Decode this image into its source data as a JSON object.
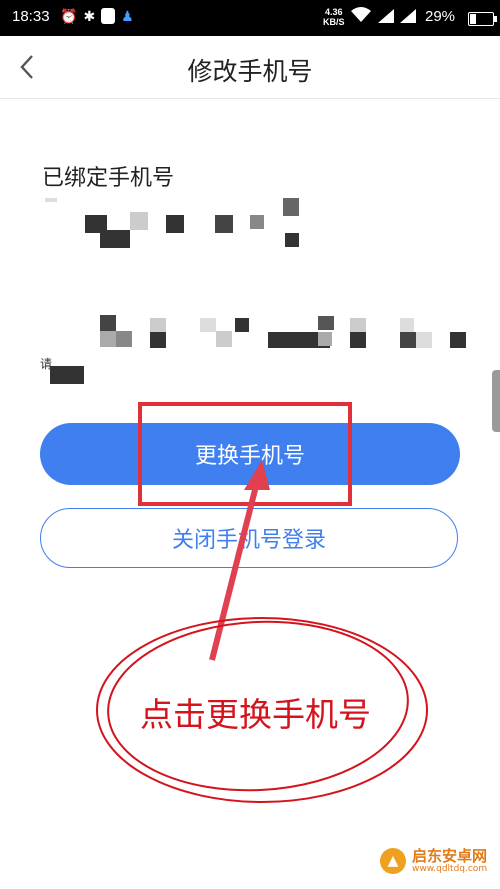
{
  "statusbar": {
    "time": "18:33",
    "speed_value": "4.36",
    "speed_unit": "KB/S",
    "battery": "29%",
    "battery_level": 0.29,
    "icons": [
      "alarm-icon",
      "bluetooth-icon",
      "shield-icon",
      "qq-icon",
      "wifi-icon",
      "signal-icon"
    ]
  },
  "header": {
    "title": "修改手机号",
    "back_icon": "chevron-left-icon"
  },
  "main": {
    "bound_label": "已绑定手机号",
    "hint_prefix": "请",
    "primary_button": "更换手机号",
    "secondary_button": "关闭手机号登录"
  },
  "annotation": {
    "text": "点击更换手机号",
    "color": "#d4141c"
  },
  "watermark": {
    "name": "启东安卓网",
    "url": "www.qdltdq.com"
  },
  "colors": {
    "accent": "#3f7ff0",
    "annotation": "#d4141c"
  }
}
